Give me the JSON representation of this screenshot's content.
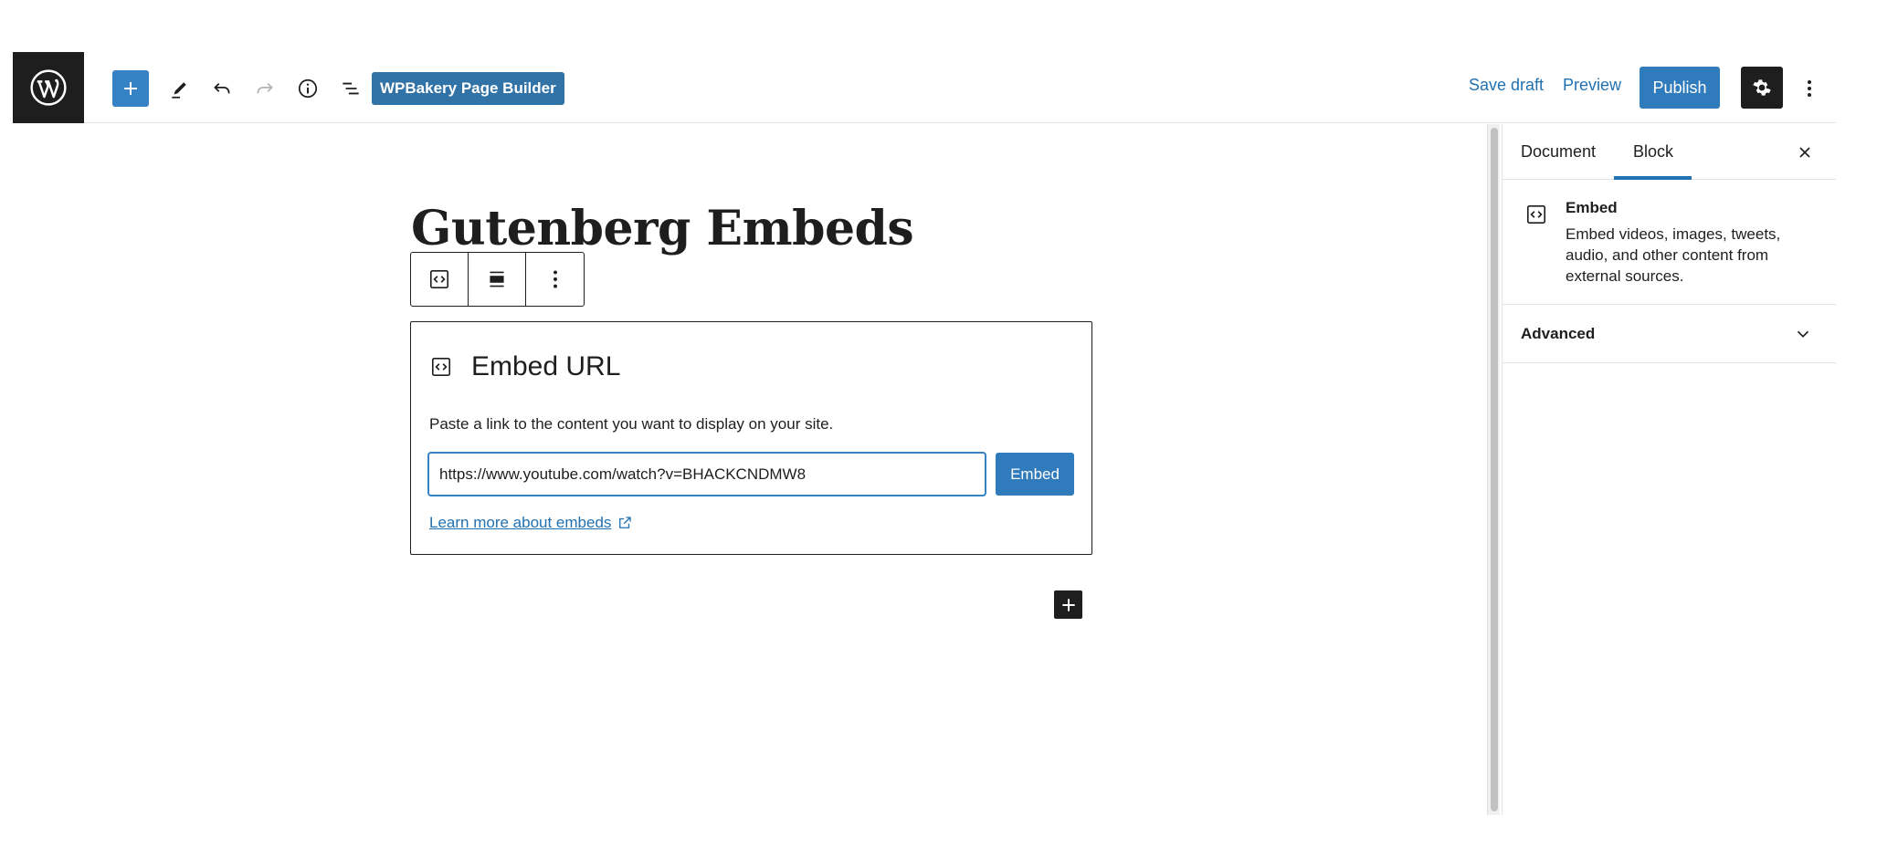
{
  "toolbar": {
    "wpbakery_label": "WPBakery Page Builder",
    "save_draft_label": "Save draft",
    "preview_label": "Preview",
    "publish_label": "Publish"
  },
  "icons": {
    "logo": "wordpress-logo-icon",
    "add": "plus-icon",
    "edit": "pencil-icon",
    "undo": "undo-icon",
    "redo": "redo-icon",
    "info": "info-icon",
    "outline": "list-view-icon",
    "settings": "gear-icon",
    "more": "vertical-ellipsis-icon",
    "embed": "embed-icon",
    "align": "align-center-icon",
    "external": "external-link-icon",
    "close": "close-icon",
    "chevron": "chevron-down-icon"
  },
  "editor": {
    "title": "Gutenberg Embeds",
    "embed": {
      "heading": "Embed URL",
      "description": "Paste a link to the content you want to display on your site.",
      "url_value": "https://www.youtube.com/watch?v=BHACKCNDMW8",
      "submit_label": "Embed",
      "learn_more_label": "Learn more about embeds"
    }
  },
  "sidebar": {
    "tabs": [
      "Document",
      "Block"
    ],
    "active_tab": "Block",
    "block_card": {
      "title": "Embed",
      "description": "Embed videos, images, tweets, audio, and other content from external sources."
    },
    "panels": [
      {
        "label": "Advanced",
        "expanded": false
      }
    ]
  },
  "colors": {
    "accent": "#2f7bbb",
    "link": "#2271b1",
    "dark": "#1e1e1e"
  }
}
